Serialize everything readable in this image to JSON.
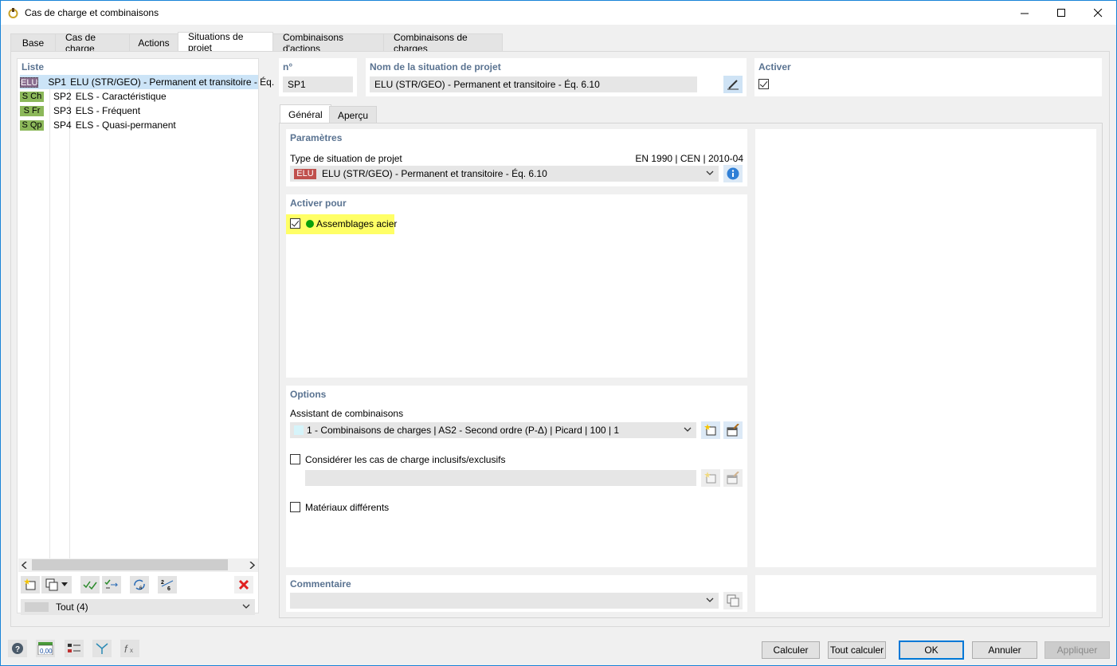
{
  "window": {
    "title": "Cas de charge et combinaisons"
  },
  "tabs": [
    "Base",
    "Cas de charge",
    "Actions",
    "Situations de projet",
    "Combinaisons d'actions",
    "Combinaisons de charges"
  ],
  "list": {
    "header": "Liste",
    "items": [
      {
        "tag": "ELU",
        "tag_color": "#8a6d8f",
        "id": "SP1",
        "label": "ELU (STR/GEO) - Permanent et transitoire - Éq.",
        "selected": true
      },
      {
        "tag": "S Ch",
        "tag_color": "#8cb85a",
        "id": "SP2",
        "label": "ELS - Caractéristique"
      },
      {
        "tag": "S Fr",
        "tag_color": "#8cb85a",
        "id": "SP3",
        "label": "ELS - Fréquent"
      },
      {
        "tag": "S Qp",
        "tag_color": "#8cb85a",
        "id": "SP4",
        "label": "ELS - Quasi-permanent"
      }
    ],
    "filter": "Tout (4)"
  },
  "number": {
    "label": "n°",
    "value": "SP1"
  },
  "name": {
    "label": "Nom de la situation de projet",
    "value": "ELU (STR/GEO) - Permanent et transitoire - Éq. 6.10"
  },
  "activate": {
    "label": "Activer",
    "checked": true
  },
  "subtabs": [
    "Général",
    "Aperçu"
  ],
  "params": {
    "header": "Paramètres",
    "type_label": "Type de situation de projet",
    "standard": "EN 1990 | CEN | 2010-04",
    "type_tag": "ELU",
    "type_value": "ELU (STR/GEO) - Permanent et transitoire - Éq. 6.10"
  },
  "activate_for": {
    "header": "Activer pour",
    "item": "Assemblages acier"
  },
  "options": {
    "header": "Options",
    "assistant_label": "Assistant de combinaisons",
    "assistant_value": "1 - Combinaisons de charges | AS2 - Second ordre (P-Δ) | Picard | 100 | 1",
    "inclusive_label": "Considérer les cas de charge inclusifs/exclusifs",
    "materials_label": "Matériaux différents"
  },
  "comment": {
    "header": "Commentaire"
  },
  "buttons": {
    "calculate": "Calculer",
    "calculate_all": "Tout calculer",
    "ok": "OK",
    "cancel": "Annuler",
    "apply": "Appliquer"
  },
  "colors": {
    "accent": "#0078d7",
    "group_header": "#5a7391",
    "elu_red": "#c0504d",
    "highlight": "#ffff66"
  }
}
